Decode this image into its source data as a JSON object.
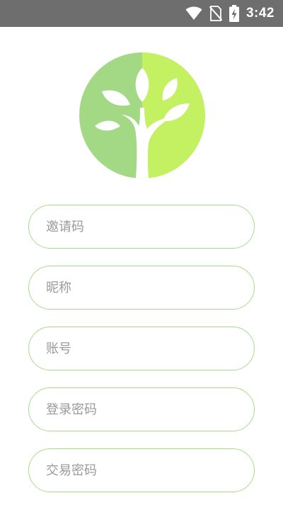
{
  "status_bar": {
    "time": "3:42",
    "icons": [
      "wifi-icon",
      "no-sim-icon",
      "battery-charging-icon"
    ]
  },
  "logo": {
    "icon": "tree-logo-icon",
    "colors": {
      "left_half": "#a3d985",
      "right_half": "#c3f162",
      "leaves": "#ffffff"
    }
  },
  "form": {
    "fields": [
      {
        "placeholder": "邀请码",
        "value": ""
      },
      {
        "placeholder": "昵称",
        "value": ""
      },
      {
        "placeholder": "账号",
        "value": ""
      },
      {
        "placeholder": "登录密码",
        "value": ""
      },
      {
        "placeholder": "交易密码",
        "value": ""
      }
    ],
    "border_color": "#a8dc8c"
  }
}
